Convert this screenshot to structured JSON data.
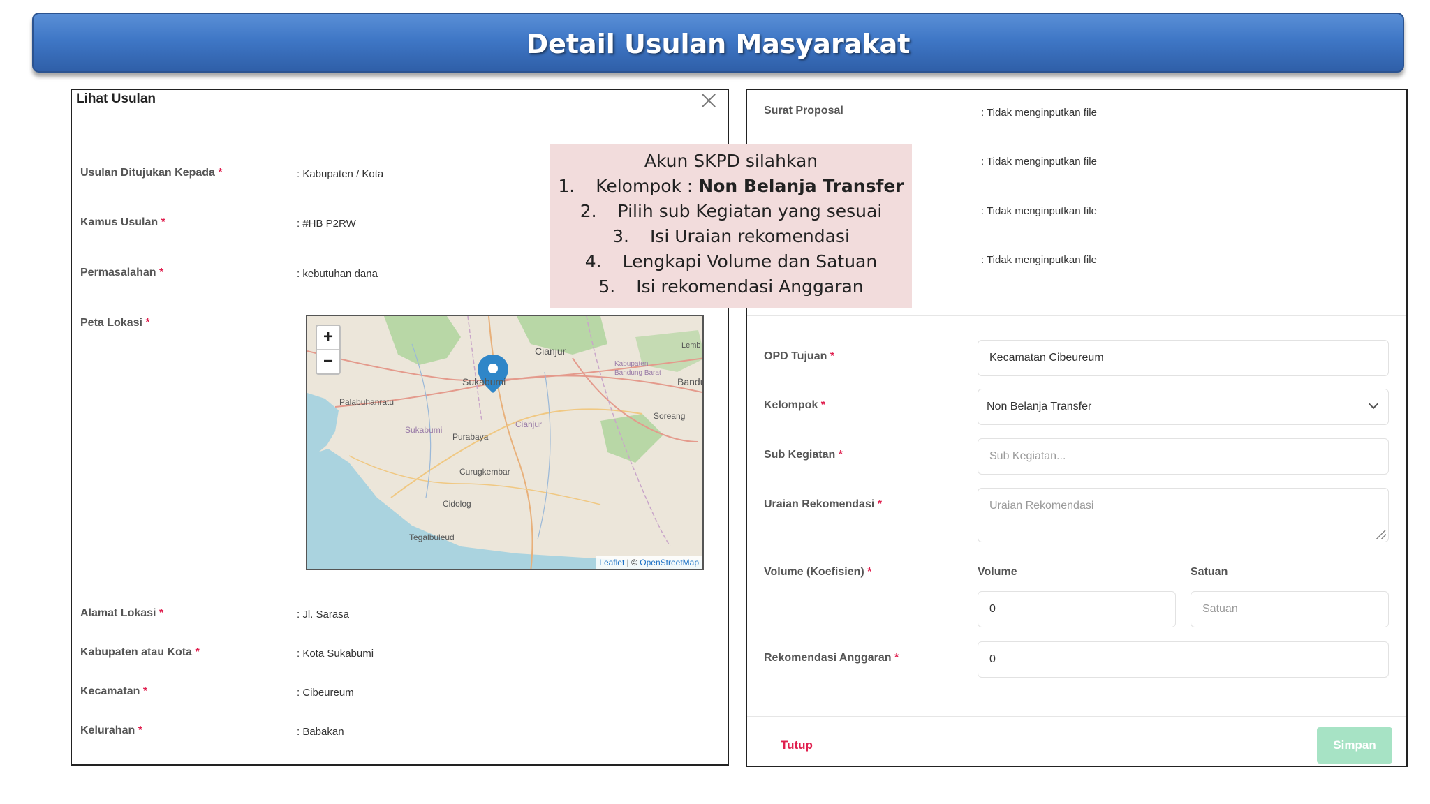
{
  "banner": {
    "title": "Detail Usulan Masyarakat"
  },
  "left": {
    "modal_title": "Lihat Usulan",
    "fields": [
      {
        "label": "Usulan Ditujukan Kepada",
        "value": ": Kabupaten / Kota"
      },
      {
        "label": "Kamus Usulan",
        "value": ": #HB P2RW"
      },
      {
        "label": "Permasalahan",
        "value": ": kebutuhan dana"
      },
      {
        "label": "Peta Lokasi",
        "value": ""
      },
      {
        "label": "Alamat Lokasi",
        "value": ": Jl. Sarasa"
      },
      {
        "label": "Kabupaten atau Kota",
        "value": ": Kota Sukabumi"
      },
      {
        "label": "Kecamatan",
        "value": ": Cibeureum"
      },
      {
        "label": "Kelurahan",
        "value": ": Babakan"
      }
    ],
    "map": {
      "zoom_in": "+",
      "zoom_out": "−",
      "places": [
        "Cianjur",
        "Sukabumi",
        "Palabuhanratu",
        "Kabupaten Bandung Barat",
        "Bandu",
        "Soreang",
        "Cianjur",
        "Sukabumi",
        "Purabaya",
        "Curugkembar",
        "Cidolog",
        "Tegalbuleud",
        "Lemb"
      ],
      "attribution_leaflet": "Leaflet",
      "attribution_sep": " | © ",
      "attribution_osm": "OpenStreetMap"
    }
  },
  "callout": {
    "heading": "Akun SKPD silahkan",
    "steps": [
      {
        "num": "1.",
        "text": "Kelompok : ",
        "bold": "Non Belanja Transfer"
      },
      {
        "num": "2.",
        "text": "Pilih sub Kegiatan yang sesuai",
        "bold": ""
      },
      {
        "num": "3.",
        "text": "Isi Uraian rekomendasi",
        "bold": ""
      },
      {
        "num": "4.",
        "text": "Lengkapi Volume dan Satuan",
        "bold": ""
      },
      {
        "num": "5.",
        "text": "Isi rekomendasi Anggaran",
        "bold": ""
      }
    ]
  },
  "right": {
    "file_label": "Surat Proposal",
    "file_values": [
      ": Tidak menginputkan file",
      ": Tidak menginputkan file",
      ": Tidak menginputkan file",
      ": Tidak menginputkan file"
    ],
    "opd_label": "OPD Tujuan",
    "opd_value": "Kecamatan Cibeureum",
    "kelompok_label": "Kelompok",
    "kelompok_value": "Non Belanja Transfer",
    "sub_label": "Sub Kegiatan",
    "sub_placeholder": "Sub Kegiatan...",
    "uraian_label": "Uraian Rekomendasi",
    "uraian_placeholder": "Uraian Rekomendasi",
    "volume_label": "Volume (Koefisien)",
    "volume_header": "Volume",
    "satuan_header": "Satuan",
    "volume_value": "0",
    "satuan_placeholder": "Satuan",
    "anggaran_label": "Rekomendasi Anggaran",
    "anggaran_value": "0",
    "tutup": "Tutup",
    "simpan": "Simpan",
    "required_mark": "*"
  }
}
